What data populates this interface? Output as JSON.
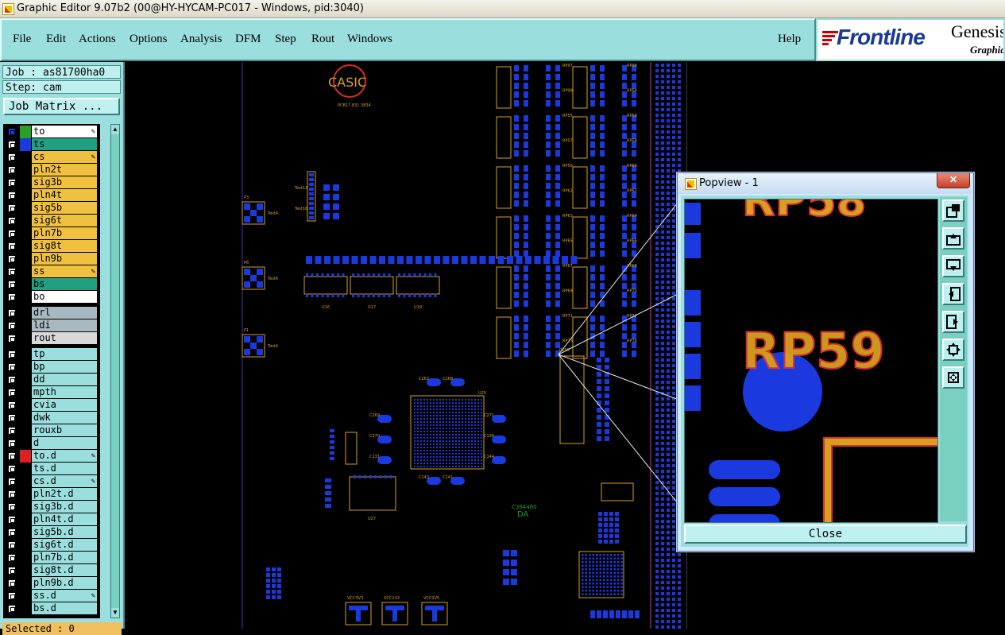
{
  "window": {
    "title": "Graphic Editor 9.07b2 (00@HY-HYCAM-PC017 - Windows, pid:3040)"
  },
  "menu": {
    "items": [
      "File",
      "Edit",
      "Actions",
      "Options",
      "Analysis",
      "DFM",
      "Step",
      "Rout",
      "Windows"
    ],
    "help": "Help"
  },
  "brand": {
    "logo": "Frontline",
    "product": "Genesis",
    "subtitle": "Graphic"
  },
  "job": {
    "job_label": "Job : as81700ha0",
    "step_label": "Step: cam",
    "matrix_button": "Job Matrix ..."
  },
  "layers": [
    {
      "name": "to",
      "bg": "#ffffff",
      "swatch": "#2aa02a",
      "pen": true,
      "active": true
    },
    {
      "name": "ts",
      "bg": "#20a080",
      "swatch": "#1a3ae0",
      "pen": false
    },
    {
      "name": "cs",
      "bg": "#f0c040",
      "swatch": "",
      "pen": true
    },
    {
      "name": "pln2t",
      "bg": "#f0c040",
      "swatch": "",
      "pen": false
    },
    {
      "name": "sig3b",
      "bg": "#f0c040",
      "swatch": "",
      "pen": false
    },
    {
      "name": "pln4t",
      "bg": "#f0c040",
      "swatch": "",
      "pen": false
    },
    {
      "name": "sig5b",
      "bg": "#f0c040",
      "swatch": "",
      "pen": false
    },
    {
      "name": "sig6t",
      "bg": "#f0c040",
      "swatch": "",
      "pen": false
    },
    {
      "name": "pln7b",
      "bg": "#f0c040",
      "swatch": "",
      "pen": false
    },
    {
      "name": "sig8t",
      "bg": "#f0c040",
      "swatch": "",
      "pen": false
    },
    {
      "name": "pln9b",
      "bg": "#f0c040",
      "swatch": "",
      "pen": false
    },
    {
      "name": "ss",
      "bg": "#f0c040",
      "swatch": "",
      "pen": true
    },
    {
      "name": "bs",
      "bg": "#20a080",
      "swatch": "",
      "pen": false
    },
    {
      "name": "bo",
      "bg": "#ffffff",
      "swatch": "",
      "pen": false
    },
    {
      "name": "drl",
      "bg": "#a8b8c0",
      "swatch": "",
      "pen": false
    },
    {
      "name": "ldi",
      "bg": "#a8b8c0",
      "swatch": "",
      "pen": false
    },
    {
      "name": "rout",
      "bg": "#d8d8d8",
      "swatch": "",
      "pen": false
    },
    {
      "name": "tp",
      "bg": "#9adede",
      "swatch": "",
      "pen": false
    },
    {
      "name": "bp",
      "bg": "#9adede",
      "swatch": "",
      "pen": false
    },
    {
      "name": "dd",
      "bg": "#9adede",
      "swatch": "",
      "pen": false
    },
    {
      "name": "mpth",
      "bg": "#9adede",
      "swatch": "",
      "pen": false
    },
    {
      "name": "cvia",
      "bg": "#9adede",
      "swatch": "",
      "pen": false
    },
    {
      "name": "dwk",
      "bg": "#9adede",
      "swatch": "",
      "pen": false
    },
    {
      "name": "rouxb",
      "bg": "#9adede",
      "swatch": "",
      "pen": false
    },
    {
      "name": "d",
      "bg": "#9adede",
      "swatch": "",
      "pen": false
    },
    {
      "name": "to.d",
      "bg": "#9adede",
      "swatch": "#e02020",
      "pen": true
    },
    {
      "name": "ts.d",
      "bg": "#9adede",
      "swatch": "",
      "pen": false
    },
    {
      "name": "cs.d",
      "bg": "#9adede",
      "swatch": "",
      "pen": true
    },
    {
      "name": "pln2t.d",
      "bg": "#9adede",
      "swatch": "",
      "pen": false
    },
    {
      "name": "sig3b.d",
      "bg": "#9adede",
      "swatch": "",
      "pen": false
    },
    {
      "name": "pln4t.d",
      "bg": "#9adede",
      "swatch": "",
      "pen": false
    },
    {
      "name": "sig5b.d",
      "bg": "#9adede",
      "swatch": "",
      "pen": false
    },
    {
      "name": "sig6t.d",
      "bg": "#9adede",
      "swatch": "",
      "pen": false
    },
    {
      "name": "pln7b.d",
      "bg": "#9adede",
      "swatch": "",
      "pen": false
    },
    {
      "name": "sig8t.d",
      "bg": "#9adede",
      "swatch": "",
      "pen": false
    },
    {
      "name": "pln9b.d",
      "bg": "#9adede",
      "swatch": "",
      "pen": false
    },
    {
      "name": "ss.d",
      "bg": "#9adede",
      "swatch": "",
      "pen": true
    },
    {
      "name": "bs.d",
      "bg": "#9adede",
      "swatch": "",
      "pen": false
    }
  ],
  "status": {
    "selected": "Selected : 0"
  },
  "board": {
    "logo_text": "CASIC",
    "logo_sub": "PCB17.831.3834",
    "labels": [
      "U18",
      "U14",
      "U13",
      "U12",
      "U11",
      "U10",
      "U9",
      "U8",
      "U7",
      "U6",
      "U5",
      "U4",
      "U3",
      "U2",
      "U16",
      "U17",
      "U19",
      "U20",
      "U25",
      "U27",
      "U28",
      "U15",
      "P3",
      "P6",
      "P1",
      "Test4",
      "Test6",
      "Test13",
      "Test16",
      "C262",
      "C268",
      "C269",
      "C270",
      "C271",
      "C130",
      "C131",
      "C144",
      "C143",
      "C141",
      "C145",
      "C146",
      "C148",
      "C149",
      "C138",
      "C139",
      "C140",
      "C136",
      "C137",
      "C135",
      "RP96",
      "RP97",
      "RP98",
      "RP99",
      "RP54",
      "RP55",
      "RP56",
      "RP57",
      "RP58",
      "RP59",
      "RP60",
      "RP61",
      "RP62",
      "RP63",
      "RP64",
      "RP65",
      "RP66",
      "RP67",
      "RP68",
      "RP69",
      "RP70",
      "RP71",
      "RP72",
      "RP73",
      "RP74",
      "RP75",
      "RP76",
      "RP77",
      "RP78",
      "RP79",
      "RP80",
      "RP81",
      "RP82",
      "RP83",
      "RP84",
      "RP85",
      "RP86",
      "RP87",
      "RP88",
      "RP89",
      "RP90",
      "RP91",
      "RP92",
      "RP93",
      "RP94",
      "RP95",
      "VCC3V3",
      "VCC1V2",
      "VCC2V5",
      "C384460",
      "DA"
    ]
  },
  "popview": {
    "title": "Popview - 1",
    "zoom_label_top": "RP58",
    "zoom_label": "RP59",
    "close_button": "Close",
    "tools": [
      "zoom-fit-icon",
      "zoom-up-icon",
      "zoom-down-icon",
      "pan-left-icon",
      "pan-right-icon",
      "zoom-in-icon",
      "zoom-out-icon"
    ]
  },
  "colors": {
    "panel": "#9adede",
    "pad": "#1a3ae0",
    "silk": "#d8a020",
    "outline": "#e03030"
  }
}
